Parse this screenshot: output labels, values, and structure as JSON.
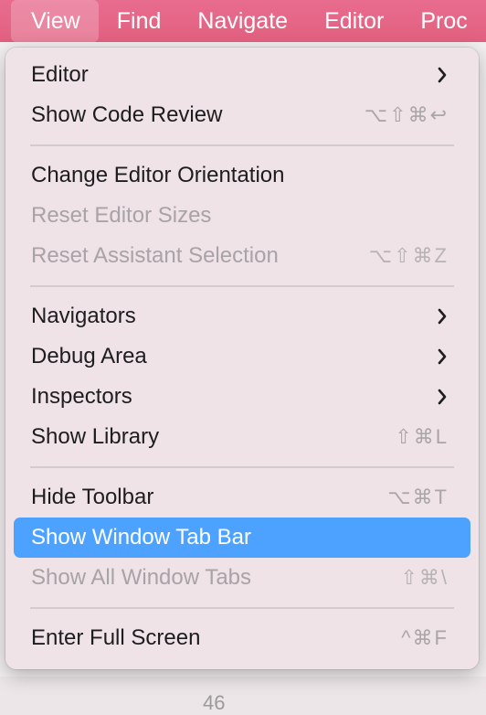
{
  "menubar": {
    "items": [
      {
        "label": "View"
      },
      {
        "label": "Find"
      },
      {
        "label": "Navigate"
      },
      {
        "label": "Editor"
      },
      {
        "label": "Proc"
      }
    ]
  },
  "menu": {
    "items": [
      {
        "label": "Editor",
        "submenu": true,
        "disabled": false
      },
      {
        "label": "Show Code Review",
        "shortcut": "⌥⇧⌘↩",
        "disabled": false
      },
      {
        "separator": true
      },
      {
        "label": "Change Editor Orientation",
        "disabled": false
      },
      {
        "label": "Reset Editor Sizes",
        "disabled": true
      },
      {
        "label": "Reset Assistant Selection",
        "shortcut": "⌥⇧⌘Z",
        "disabled": true
      },
      {
        "separator": true
      },
      {
        "label": "Navigators",
        "submenu": true,
        "disabled": false
      },
      {
        "label": "Debug Area",
        "submenu": true,
        "disabled": false
      },
      {
        "label": "Inspectors",
        "submenu": true,
        "disabled": false
      },
      {
        "label": "Show Library",
        "shortcut": "⇧⌘L",
        "disabled": false
      },
      {
        "separator": true
      },
      {
        "label": "Hide Toolbar",
        "shortcut": "⌥⌘T",
        "disabled": false
      },
      {
        "label": "Show Window Tab Bar",
        "disabled": false,
        "highlighted": true
      },
      {
        "label": "Show All Window Tabs",
        "shortcut": "⇧⌘\\",
        "disabled": true
      },
      {
        "separator": true
      },
      {
        "label": "Enter Full Screen",
        "shortcut": "^⌘F",
        "disabled": false
      }
    ]
  },
  "background": {
    "line_number": "46"
  },
  "colors": {
    "menubar": "#e2607f",
    "highlight": "#4ea2ff"
  }
}
